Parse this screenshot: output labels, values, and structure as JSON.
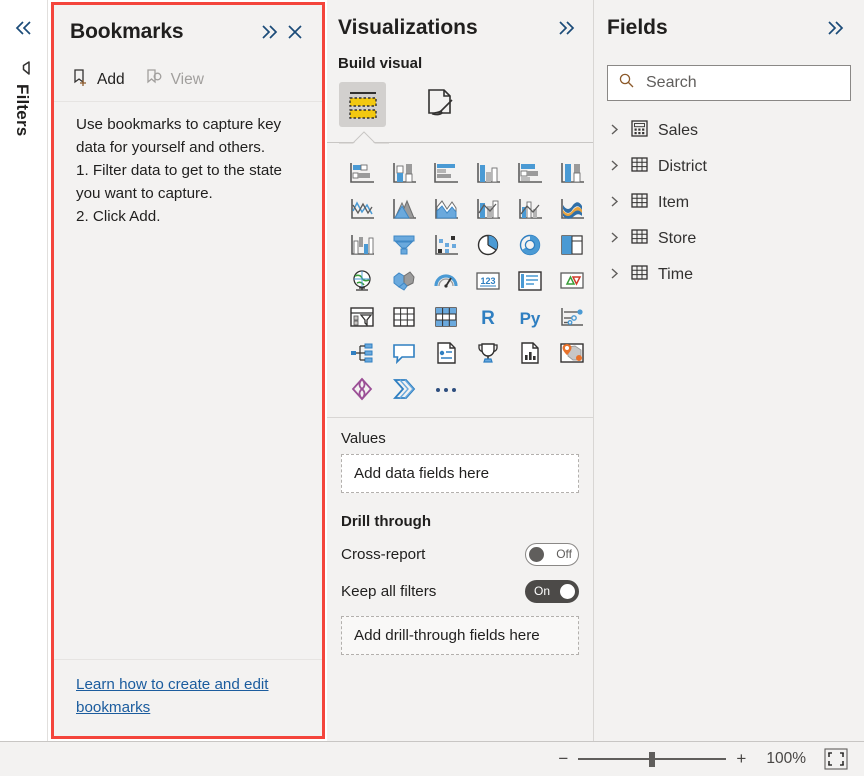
{
  "left_rail": {
    "collapse_icon": "double-chevron-left-icon",
    "filter_icon": "filter-icon",
    "label": "Filters"
  },
  "bookmarks": {
    "title": "Bookmarks",
    "expand_icon": "double-chevron-right-icon",
    "close_icon": "close-icon",
    "toolbar": {
      "add_label": "Add",
      "add_icon": "bookmark-add-icon",
      "view_label": "View",
      "view_icon": "bookmark-view-icon"
    },
    "help_text": "Use bookmarks to capture key data for yourself and others.\n1. Filter data to get to the state you want to capture.\n2. Click Add.",
    "footer_link": "Learn how to create and edit bookmarks",
    "highlight_color": "#f4453c"
  },
  "visualizations": {
    "title": "Visualizations",
    "expand_icon": "double-chevron-right-icon",
    "build_label": "Build visual",
    "tabs": [
      {
        "name": "build-visual-tab",
        "icon": "fields-build-icon",
        "active": true
      },
      {
        "name": "format-visual-tab",
        "icon": "paintbrush-page-icon",
        "active": false
      }
    ],
    "gallery": [
      "stacked-bar-chart",
      "stacked-column-chart",
      "clustered-bar-chart",
      "clustered-column-chart",
      "hundred-percent-stacked-bar-chart",
      "hundred-percent-stacked-column-chart",
      "line-chart",
      "area-chart",
      "stacked-area-chart",
      "line-and-stacked-column-chart",
      "line-and-clustered-column-chart",
      "ribbon-chart",
      "waterfall-chart",
      "funnel-chart",
      "scatter-chart",
      "pie-chart",
      "donut-chart",
      "treemap",
      "map",
      "filled-map",
      "gauge",
      "card",
      "multi-row-card",
      "kpi",
      "slicer",
      "table",
      "matrix",
      "r-script-visual",
      "python-visual",
      "key-influencers",
      "decomposition-tree",
      "qna-visual",
      "smart-narrative",
      "paginated-report",
      "power-apps-visual",
      "arcgis-maps",
      "powerbi-visuals-azure-map",
      "power-automate-visual",
      "more-options-ellipsis"
    ],
    "values_label": "Values",
    "values_placeholder": "Add data fields here",
    "drill_through_label": "Drill through",
    "cross_report": {
      "label": "Cross-report",
      "state": "Off"
    },
    "keep_all_filters": {
      "label": "Keep all filters",
      "state": "On"
    },
    "drill_placeholder": "Add drill-through fields here"
  },
  "fields": {
    "title": "Fields",
    "expand_icon": "double-chevron-right-icon",
    "search": {
      "icon": "search-icon",
      "placeholder": "Search",
      "value": ""
    },
    "tree": [
      {
        "label": "Sales",
        "icon": "measure-table-icon",
        "chevron": "chevron-right-icon"
      },
      {
        "label": "District",
        "icon": "table-icon",
        "chevron": "chevron-right-icon"
      },
      {
        "label": "Item",
        "icon": "table-icon",
        "chevron": "chevron-right-icon"
      },
      {
        "label": "Store",
        "icon": "table-icon",
        "chevron": "chevron-right-icon"
      },
      {
        "label": "Time",
        "icon": "table-icon",
        "chevron": "chevron-right-icon"
      }
    ]
  },
  "status_bar": {
    "zoom_out_label": "−",
    "zoom_in_label": "+",
    "zoom_level": "100%",
    "fit_icon": "fit-to-page-icon"
  }
}
